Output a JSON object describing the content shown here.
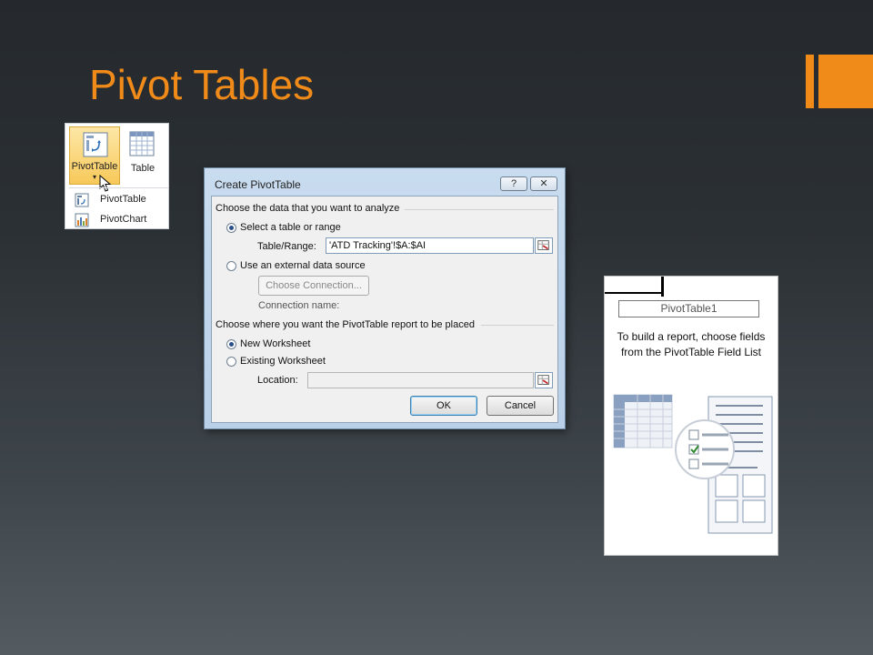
{
  "slide": {
    "title": "Pivot Tables",
    "accent_color": "#f08a19"
  },
  "ribbon": {
    "pivot_button_label": "PivotTable",
    "table_button_label": "Table",
    "dropdown_arrow": "▾",
    "menu_items": [
      {
        "label": "PivotTable",
        "icon": "pivottable-icon"
      },
      {
        "label": "PivotChart",
        "icon": "pivotchart-icon"
      }
    ]
  },
  "dialog": {
    "title": "Create PivotTable",
    "help_glyph": "?",
    "close_glyph": "✕",
    "section1": "Choose the data that you want to analyze",
    "radio_table": "Select a table or range",
    "table_range_label": "Table/Range:",
    "table_range_value": "'ATD Tracking'!$A:$AI",
    "radio_external": "Use an external data source",
    "choose_connection": "Choose Connection...",
    "connection_name_label": "Connection name:",
    "section2": "Choose where you want the PivotTable report to be placed",
    "radio_new": "New Worksheet",
    "radio_existing": "Existing Worksheet",
    "location_label": "Location:",
    "location_value": "",
    "ok": "OK",
    "cancel": "Cancel"
  },
  "pivot_placeholder": {
    "name": "PivotTable1",
    "help_line1": "To build a report, choose fields",
    "help_line2": "from the PivotTable Field List"
  }
}
